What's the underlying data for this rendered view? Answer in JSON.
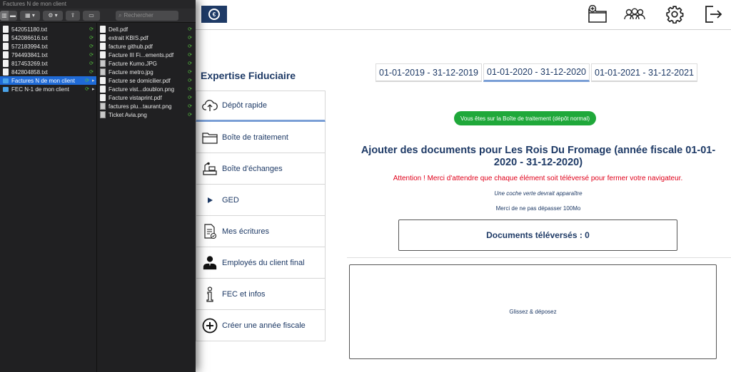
{
  "finder": {
    "window_title": "Factures N de mon client",
    "search_placeholder": "Rechercher",
    "column1": [
      {
        "name": "542051180.txt",
        "kind": "doc"
      },
      {
        "name": "542086616.txt",
        "kind": "doc"
      },
      {
        "name": "572183994.txt",
        "kind": "doc"
      },
      {
        "name": "794493841.txt",
        "kind": "doc"
      },
      {
        "name": "817453269.txt",
        "kind": "doc"
      },
      {
        "name": "842804858.txt",
        "kind": "doc"
      },
      {
        "name": "Factures N de mon client",
        "kind": "folder",
        "selected": true
      },
      {
        "name": "FEC N-1 de mon client",
        "kind": "folder"
      }
    ],
    "column2": [
      {
        "name": "Dell.pdf",
        "kind": "doc"
      },
      {
        "name": "extrait KBIS.pdf",
        "kind": "doc"
      },
      {
        "name": "facture github.pdf",
        "kind": "doc"
      },
      {
        "name": "Facture III Fi...ements.pdf",
        "kind": "doc"
      },
      {
        "name": "Facture Kumo.JPG",
        "kind": "img"
      },
      {
        "name": "Facture metro.jpg",
        "kind": "img"
      },
      {
        "name": "Facture se domicilier.pdf",
        "kind": "doc"
      },
      {
        "name": "Facture vist...doublon.png",
        "kind": "doc"
      },
      {
        "name": "Facture vistaprint.pdf",
        "kind": "doc"
      },
      {
        "name": "factures plu...taurant.png",
        "kind": "img"
      },
      {
        "name": "Ticket Avia.png",
        "kind": "img"
      }
    ]
  },
  "header": {
    "icons": [
      "add-folder-icon",
      "users-icon",
      "gear-icon",
      "logout-icon"
    ]
  },
  "main": {
    "brand_title": "Expertise Fiduciaire",
    "years": [
      {
        "label": "01-01-2019 - 31-12-2019",
        "active": false
      },
      {
        "label": "01-01-2020 - 31-12-2020",
        "active": true
      },
      {
        "label": "01-01-2021 - 31-12-2021",
        "active": false
      }
    ],
    "sidebar": [
      {
        "label": "Dépôt rapide",
        "icon": "cloud-upload-icon"
      },
      {
        "label": "Boîte de traitement",
        "icon": "folder-icon"
      },
      {
        "label": "Boîte d'échanges",
        "icon": "desk-icon"
      },
      {
        "label": "GED",
        "icon": "play-icon"
      },
      {
        "label": "Mes écritures",
        "icon": "document-check-icon"
      },
      {
        "label": "Employés du client final",
        "icon": "employees-icon"
      },
      {
        "label": "FEC et infos",
        "icon": "info-icon"
      },
      {
        "label": "Créer une année fiscale",
        "icon": "plus-circle-icon"
      }
    ],
    "notice": "Vous êtes sur la Boîte de traitement (dépôt normal)",
    "heading": "Ajouter des documents pour Les Rois Du Fromage (année fiscale 01-01-2020 - 31-12-2020)",
    "warning": "Attention ! Merci d'attendre que chaque élément soit téléversé pour fermer votre navigateur.",
    "hint_check": "Une coche verte devrait apparaître",
    "hint_size": "Merci de ne pas dépasser 100Mo",
    "uploaded_label": "Documents téléversés : 0",
    "dropzone_label": "Glissez & déposez"
  },
  "colors": {
    "navy": "#1e3a66",
    "accent_underline": "#7a9fd6",
    "notice_green": "#1fa83a",
    "warning_red": "#e0001a",
    "finder_selection": "#1f6ad6"
  }
}
